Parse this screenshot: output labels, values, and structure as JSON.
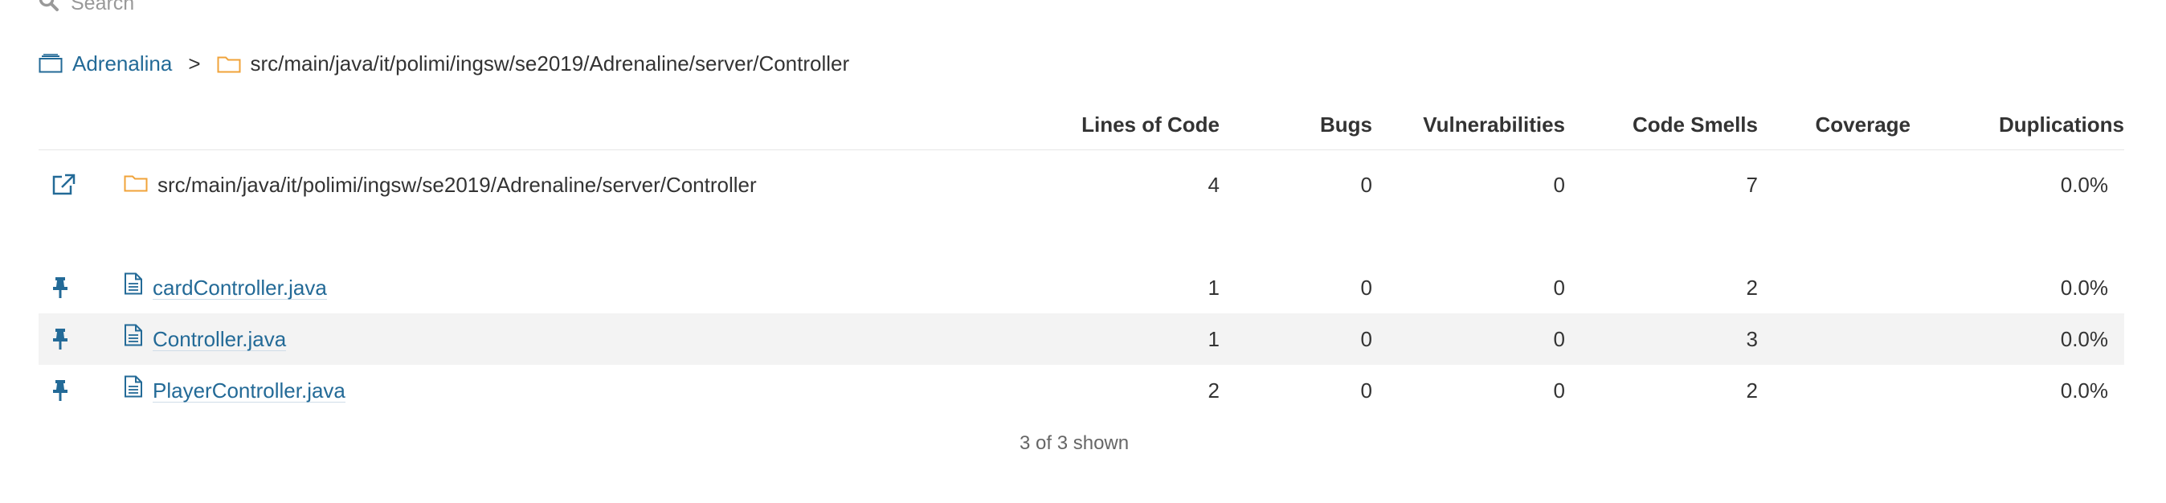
{
  "search": {
    "placeholder": "Search",
    "icon": "search-icon"
  },
  "breadcrumb": {
    "project": "Adrenalina",
    "separator": ">",
    "path": "src/main/java/it/polimi/ingsw/se2019/Adrenaline/server/Controller"
  },
  "columns": {
    "lines_of_code": "Lines of Code",
    "bugs": "Bugs",
    "vulnerabilities": "Vulnerabilities",
    "code_smells": "Code Smells",
    "coverage": "Coverage",
    "duplications": "Duplications"
  },
  "base_row": {
    "name": "src/main/java/it/polimi/ingsw/se2019/Adrenaline/server/Controller",
    "lines_of_code": "4",
    "bugs": "0",
    "vulnerabilities": "0",
    "code_smells": "7",
    "coverage": "",
    "duplications": "0.0%"
  },
  "rows": [
    {
      "name": "cardController.java",
      "lines_of_code": "1",
      "bugs": "0",
      "vulnerabilities": "0",
      "code_smells": "2",
      "coverage": "",
      "duplications": "0.0%"
    },
    {
      "name": "Controller.java",
      "lines_of_code": "1",
      "bugs": "0",
      "vulnerabilities": "0",
      "code_smells": "3",
      "coverage": "",
      "duplications": "0.0%"
    },
    {
      "name": "PlayerController.java",
      "lines_of_code": "2",
      "bugs": "0",
      "vulnerabilities": "0",
      "code_smells": "2",
      "coverage": "",
      "duplications": "0.0%"
    }
  ],
  "footer": {
    "shown": "3 of 3 shown"
  },
  "colors": {
    "link": "#236a97",
    "folder": "#f0a33a",
    "row_alt": "#f3f3f3"
  }
}
